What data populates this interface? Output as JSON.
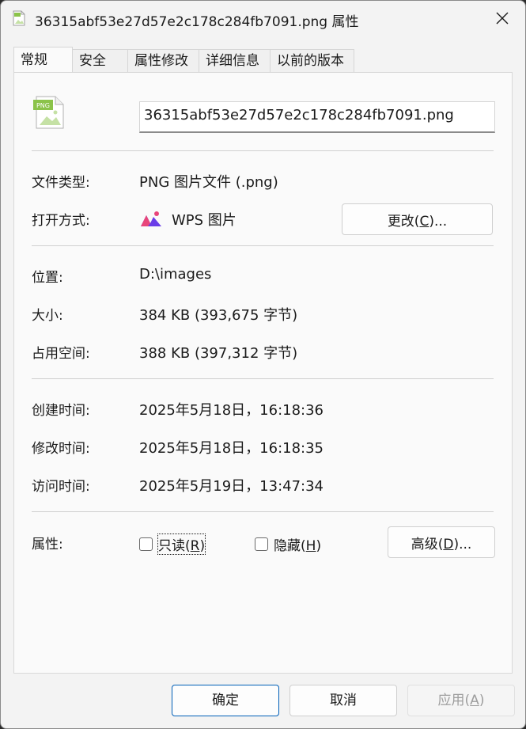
{
  "window": {
    "title": "36315abf53e27d57e2c178c284fb7091.png 属性"
  },
  "tabs": [
    {
      "label": "常规",
      "active": true
    },
    {
      "label": "安全"
    },
    {
      "label": "属性修改"
    },
    {
      "label": "详细信息"
    },
    {
      "label": "以前的版本"
    }
  ],
  "general": {
    "file_icon_text": "PNG",
    "file_name": "36315abf53e27d57e2c178c284fb7091.png",
    "file_type_label": "文件类型:",
    "file_type_value": "PNG 图片文件 (.png)",
    "open_with_label": "打开方式:",
    "open_with_value": "WPS 图片",
    "change_button": "更改(",
    "change_key": "C",
    "change_suffix": ")...",
    "location_label": "位置:",
    "location_value": "D:\\images",
    "size_label": "大小:",
    "size_value": "384 KB (393,675 字节)",
    "disk_size_label": "占用空间:",
    "disk_size_value": "388 KB (397,312 字节)",
    "created_label": "创建时间:",
    "created_value": "2025年5月18日，16:18:36",
    "modified_label": "修改时间:",
    "modified_value": "2025年5月18日，16:18:35",
    "accessed_label": "访问时间:",
    "accessed_value": "2025年5月19日，13:47:34",
    "attributes_label": "属性:",
    "readonly_label": "只读(",
    "readonly_key": "R",
    "readonly_suffix": ")",
    "hidden_label": "隐藏(",
    "hidden_key": "H",
    "hidden_suffix": ")",
    "advanced_button": "高级(",
    "advanced_key": "D",
    "advanced_suffix": ")..."
  },
  "footer": {
    "ok": "确定",
    "cancel": "取消",
    "apply": "应用(",
    "apply_key": "A",
    "apply_suffix": ")"
  },
  "colors": {
    "accent": "#005fb8",
    "disabled_text": "#9d9d9d",
    "wps_pink": "#e8457a",
    "wps_purple": "#6a3de8",
    "png_green": "#8bc34a"
  }
}
